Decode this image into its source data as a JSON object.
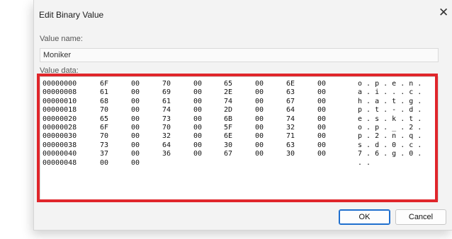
{
  "dialog": {
    "title": "Edit Binary Value",
    "close_glyph": "✕",
    "value_name_label": "Value name:",
    "value_name": "Moniker",
    "value_data_label": "Value data:",
    "highlight_color": "#e0262b",
    "rows": [
      {
        "addr": "00000000",
        "bytes": [
          "6F",
          "00",
          "70",
          "00",
          "65",
          "00",
          "6E",
          "00"
        ],
        "ascii": "o . p . e . n ."
      },
      {
        "addr": "00000008",
        "bytes": [
          "61",
          "00",
          "69",
          "00",
          "2E",
          "00",
          "63",
          "00"
        ],
        "ascii": "a . i . . . c ."
      },
      {
        "addr": "00000010",
        "bytes": [
          "68",
          "00",
          "61",
          "00",
          "74",
          "00",
          "67",
          "00"
        ],
        "ascii": "h . a . t . g ."
      },
      {
        "addr": "00000018",
        "bytes": [
          "70",
          "00",
          "74",
          "00",
          "2D",
          "00",
          "64",
          "00"
        ],
        "ascii": "p . t . - . d ."
      },
      {
        "addr": "00000020",
        "bytes": [
          "65",
          "00",
          "73",
          "00",
          "6B",
          "00",
          "74",
          "00"
        ],
        "ascii": "e . s . k . t ."
      },
      {
        "addr": "00000028",
        "bytes": [
          "6F",
          "00",
          "70",
          "00",
          "5F",
          "00",
          "32",
          "00"
        ],
        "ascii": "o . p . _ . 2 ."
      },
      {
        "addr": "00000030",
        "bytes": [
          "70",
          "00",
          "32",
          "00",
          "6E",
          "00",
          "71",
          "00"
        ],
        "ascii": "p . 2 . n . q ."
      },
      {
        "addr": "00000038",
        "bytes": [
          "73",
          "00",
          "64",
          "00",
          "30",
          "00",
          "63",
          "00"
        ],
        "ascii": "s . d . 0 . c ."
      },
      {
        "addr": "00000040",
        "bytes": [
          "37",
          "00",
          "36",
          "00",
          "67",
          "00",
          "30",
          "00"
        ],
        "ascii": "7 . 6 . g . 0 ."
      },
      {
        "addr": "00000048",
        "bytes": [
          "00",
          "00"
        ],
        "ascii": ". ."
      }
    ],
    "ok_label": "OK",
    "cancel_label": "Cancel"
  }
}
